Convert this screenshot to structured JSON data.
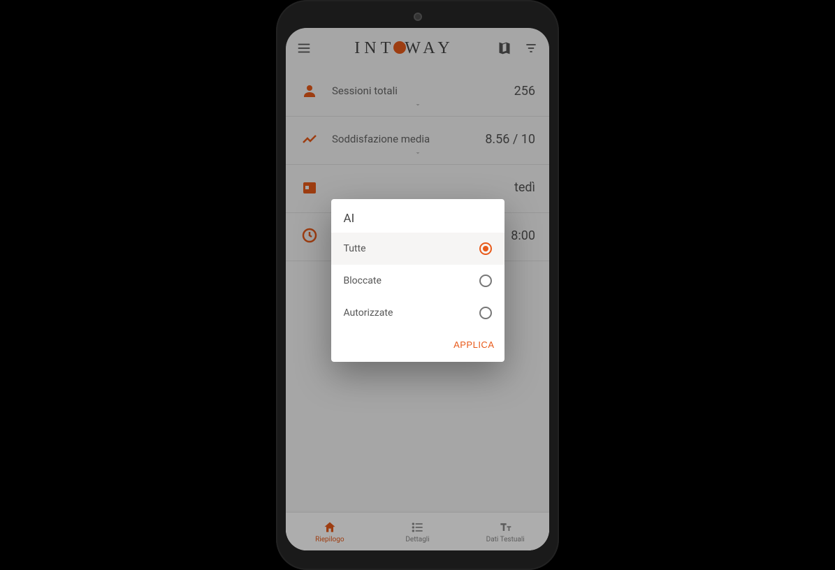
{
  "header": {
    "logo_left": "INT",
    "logo_right": "WAY"
  },
  "stats": [
    {
      "label": "Sessioni totali",
      "value": "256",
      "icon": "person-icon"
    },
    {
      "label": "Soddisfazione media",
      "value": "8.56 / 10",
      "icon": "trend-icon"
    },
    {
      "label": "",
      "value": "tedì",
      "icon": "calendar-icon"
    },
    {
      "label": "",
      "value": "8:00",
      "icon": "clock-icon"
    }
  ],
  "nav": {
    "items": [
      {
        "label": "Riepilogo",
        "active": true
      },
      {
        "label": "Dettagli",
        "active": false
      },
      {
        "label": "Dati Testuali",
        "active": false
      }
    ]
  },
  "dialog": {
    "title": "AI",
    "options": [
      {
        "label": "Tutte",
        "selected": true
      },
      {
        "label": "Bloccate",
        "selected": false
      },
      {
        "label": "Autorizzate",
        "selected": false
      }
    ],
    "apply_label": "APPLICA"
  }
}
